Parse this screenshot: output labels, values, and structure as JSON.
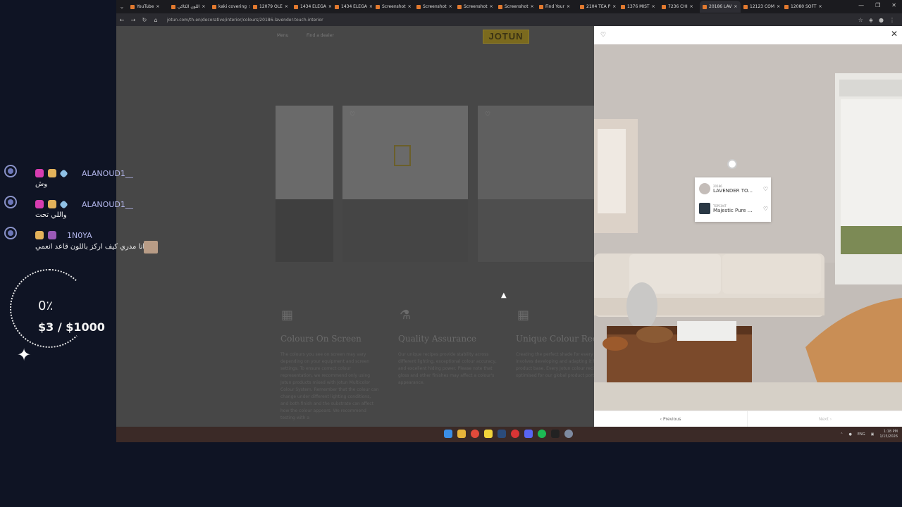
{
  "chat": [
    {
      "user": "ALANOUD1__",
      "text": "وش"
    },
    {
      "user": "ALANOUD1__",
      "text": "واللي تحت"
    },
    {
      "user": "1N0YA",
      "text": "انا مدري كيف اركز باللون قاعد انعمي"
    }
  ],
  "goal": {
    "percent": "0٪",
    "amount": "$3 / $1000"
  },
  "tabs": [
    "YouTube",
    "اللون الكاكي",
    "kaki covering",
    "12079 OLE",
    "1434 ELEGA",
    "1434 ELEGA",
    "Screenshot",
    "Screenshot",
    "Screenshot",
    "Screenshot",
    "Find Your",
    "2104 TEA P",
    "1376 MIST",
    "7236 CHI",
    "20186 LAV",
    "12123 COM",
    "12080 SOFT"
  ],
  "url": "jotun.com/th-en/decorative/interior/colours/20186-lavender-touch-interior",
  "page": {
    "menu_label": "Menu",
    "dealer_label": "Find a dealer",
    "logo": "JOTUN",
    "features": [
      {
        "title": "Colours On Screen",
        "text": "The colours you see on screen may vary depending on your equipment and screen settings. To ensure correct colour representation, we recommend only using Jotun products mixed with Jotun Multicolor Colour System. Remember that the colour can change under different lighting conditions, and both finish and the substrate can affect how the colour appears. We recommend testing with a"
      },
      {
        "title": "Quality Assurance",
        "text": "Our unique recipes provide stability across different lighting, exceptional colour accuracy, and excellent hiding power. Please note that gloss and other finishes may affect a colour's appearance."
      },
      {
        "title": "Unique Colour Recipe",
        "text": "Creating the perfect shade for every product involves developing and adapting it for each product base. Every Jotun colour recipe is optimised for our global product portfolio."
      }
    ]
  },
  "modal": {
    "swatches": [
      {
        "code": "20186",
        "name": "LAVENDER TO...",
        "color": "#c4bdb9"
      },
      {
        "code": "TOPCOAT",
        "name": "Majestic Pure ...",
        "color": "#2a3845"
      }
    ],
    "prev_label": "Previous",
    "next_label": "Next"
  },
  "tray": {
    "lang": "ENG",
    "time": "1:18 PM",
    "date": "1/15/2026"
  }
}
